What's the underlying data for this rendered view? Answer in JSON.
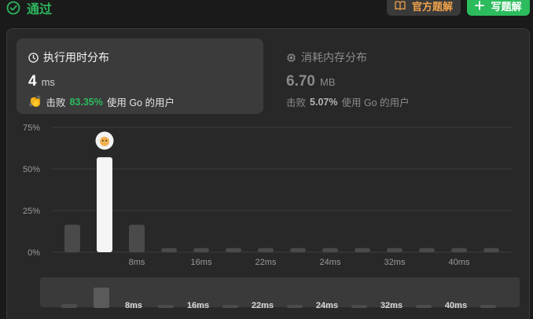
{
  "status": {
    "label": "通过",
    "icon": "check-circle-icon",
    "color": "#2db55d"
  },
  "buttons": {
    "official_solution": {
      "label": "官方题解",
      "icon": "book-icon"
    },
    "write_solution": {
      "label": "写题解",
      "icon": "plus-icon"
    }
  },
  "runtime": {
    "title": "执行用时分布",
    "icon": "clock-icon",
    "value": "4",
    "unit": "ms",
    "beats_prefix": "击败",
    "beats_pct": "83.35%",
    "beats_suffix": "使用 Go 的用户"
  },
  "memory": {
    "title": "消耗内存分布",
    "icon": "chip-icon",
    "value": "6.70",
    "unit": "MB",
    "beats_prefix": "击败",
    "beats_pct": "5.07%",
    "beats_suffix": "使用 Go 的用户"
  },
  "chart_data": {
    "type": "bar",
    "y_ticks": [
      "75%",
      "50%",
      "25%",
      "0%"
    ],
    "ylim": [
      0,
      75
    ],
    "grid": true,
    "values": [
      16.5,
      57,
      16.5,
      2.5,
      2.5,
      2.5,
      2.5,
      2.5,
      2.5,
      2.5,
      2.5,
      2.5,
      2.5,
      2.5
    ],
    "highlight_index": 1,
    "x_tick_labels": [
      {
        "bar": 2,
        "label": "8ms"
      },
      {
        "bar": 4,
        "label": "16ms"
      },
      {
        "bar": 6,
        "label": "22ms"
      },
      {
        "bar": 8,
        "label": "24ms"
      },
      {
        "bar": 10,
        "label": "32ms"
      },
      {
        "bar": 12,
        "label": "40ms"
      }
    ],
    "colors": {
      "bar": "#4a4a4a",
      "highlight": "#f5f5f5",
      "grid": "#3d3d3d"
    }
  },
  "overview": {
    "values": [
      5,
      26,
      4,
      4,
      4,
      4,
      4,
      4,
      4,
      4,
      4,
      4,
      4,
      4
    ],
    "x_tick_labels": [
      {
        "bar": 2,
        "label": "8ms"
      },
      {
        "bar": 4,
        "label": "16ms"
      },
      {
        "bar": 6,
        "label": "22ms"
      },
      {
        "bar": 8,
        "label": "24ms"
      },
      {
        "bar": 10,
        "label": "32ms"
      },
      {
        "bar": 12,
        "label": "40ms"
      }
    ]
  },
  "avatar": {
    "icon": "user-avatar-icon"
  }
}
